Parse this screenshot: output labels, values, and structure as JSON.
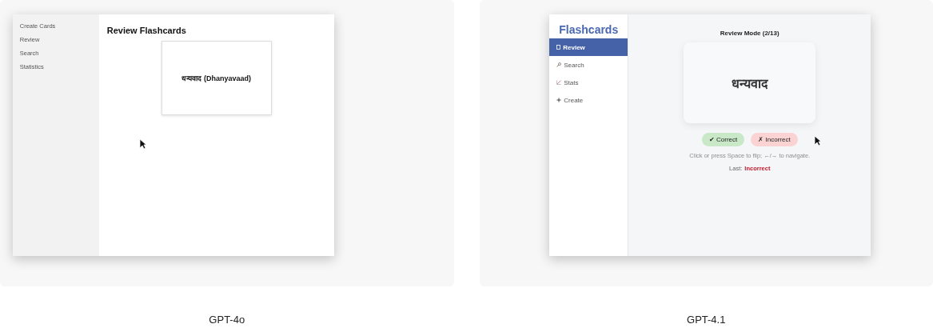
{
  "panels": [
    {
      "caption": "GPT-4o",
      "app": {
        "kind": "plain",
        "sidebar": {
          "items": [
            {
              "label": "Create Cards"
            },
            {
              "label": "Review"
            },
            {
              "label": "Search"
            },
            {
              "label": "Statistics"
            }
          ]
        },
        "heading": "Review Flashcards",
        "card_text": "धन्यवाद (Dhanyavaad)"
      }
    },
    {
      "caption": "GPT-4.1",
      "app": {
        "kind": "styled",
        "brand": "Flashcards",
        "sidebar": {
          "items": [
            {
              "label": "Review",
              "kind": "review",
              "selected": true
            },
            {
              "label": "Search",
              "kind": "search",
              "selected": false
            },
            {
              "label": "Stats",
              "kind": "stats",
              "selected": false
            },
            {
              "label": "Create",
              "kind": "create",
              "selected": false
            }
          ]
        },
        "heading": "Review Mode (2/13)",
        "card_text": "धन्यवाद",
        "buttons": [
          {
            "label": "✔ Correct",
            "kind": "correct"
          },
          {
            "label": "✗ Incorrect",
            "kind": "incorrect"
          }
        ],
        "hint": "Click or press Space to flip; ←/→ to navigate.",
        "last_label": "Last:",
        "last_result": "Incorrect"
      }
    }
  ]
}
